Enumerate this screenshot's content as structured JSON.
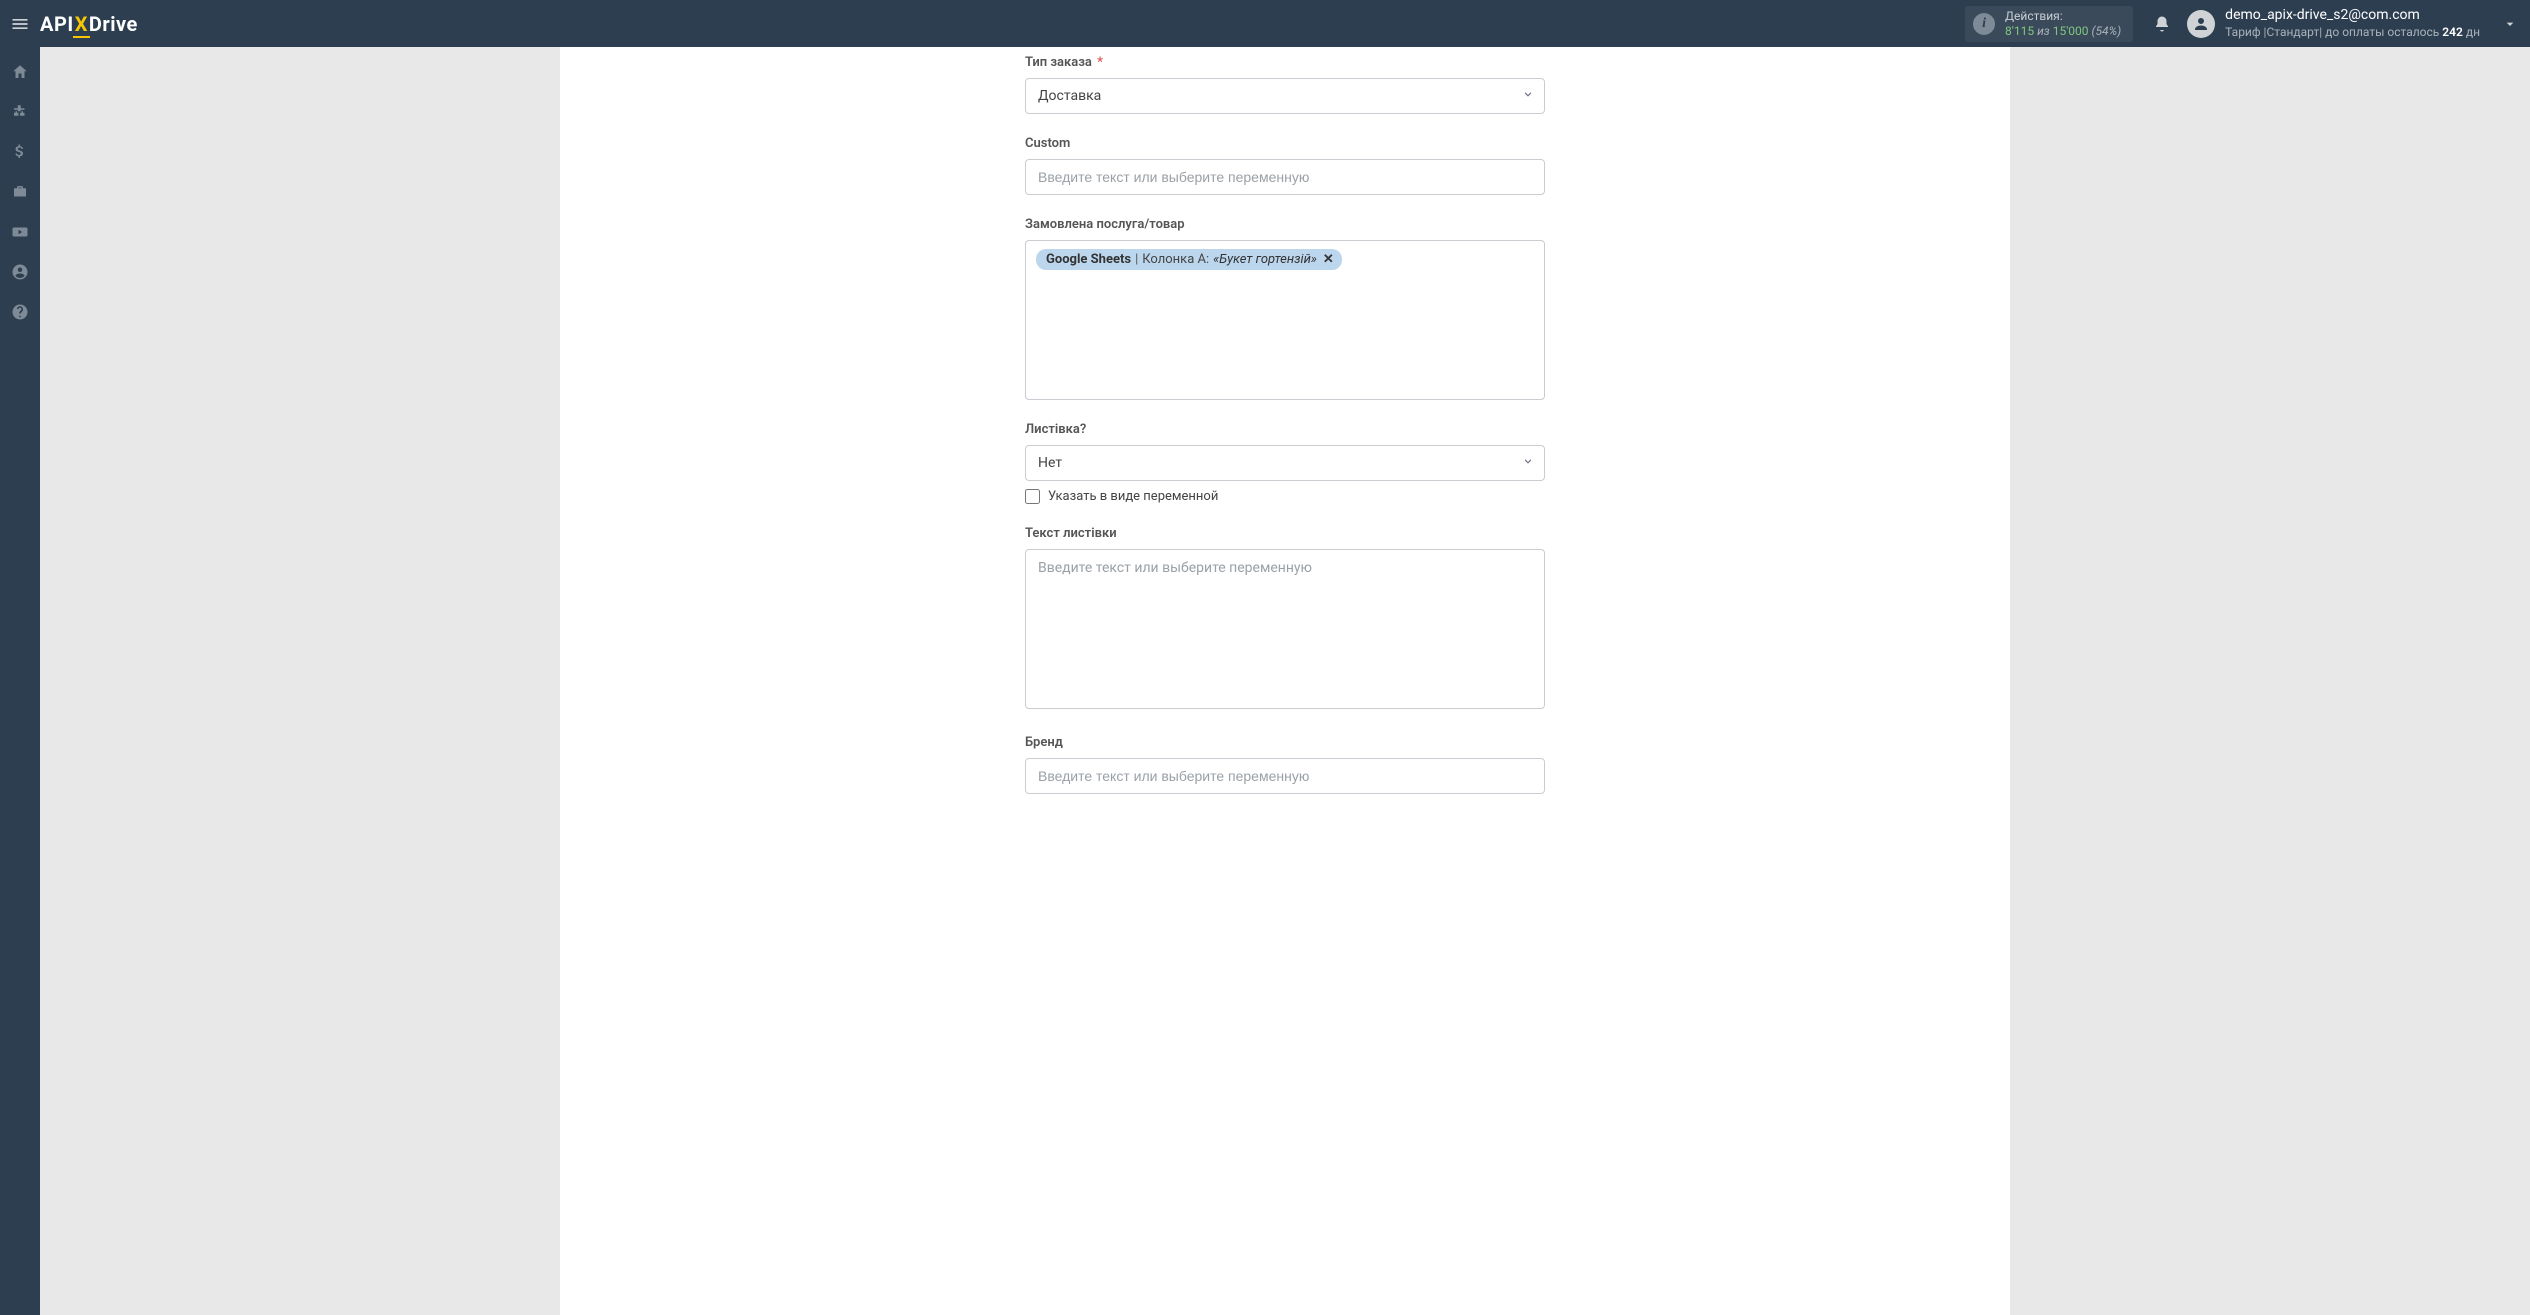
{
  "header": {
    "logo": {
      "api": "API",
      "x": "X",
      "drive": "Drive"
    },
    "actions": {
      "label": "Действия:",
      "used": "8'115",
      "of_word": "из",
      "total": "15'000",
      "pct": "(54%)"
    },
    "user": {
      "email": "demo_apix-drive_s2@com.com",
      "plan_prefix": "Тариф |Стандарт| до оплаты осталось ",
      "plan_days": "242",
      "plan_suffix": " дн"
    }
  },
  "form": {
    "order_type": {
      "label": "Тип заказа",
      "value": "Доставка"
    },
    "custom": {
      "label": "Custom",
      "placeholder": "Введите текст или выберите переменную"
    },
    "ordered": {
      "label": "Замовлена послуга/товар",
      "chip": {
        "source": "Google Sheets",
        "column_label": "Колонка A:",
        "value": "«Букет гортензій»"
      }
    },
    "postcard": {
      "label": "Листівка?",
      "value": "Нет",
      "checkbox_label": "Указать в виде переменной"
    },
    "postcard_text": {
      "label": "Текст листівки",
      "placeholder": "Введите текст или выберите переменную"
    },
    "brand": {
      "label": "Бренд",
      "placeholder": "Введите текст или выберите переменную"
    }
  }
}
